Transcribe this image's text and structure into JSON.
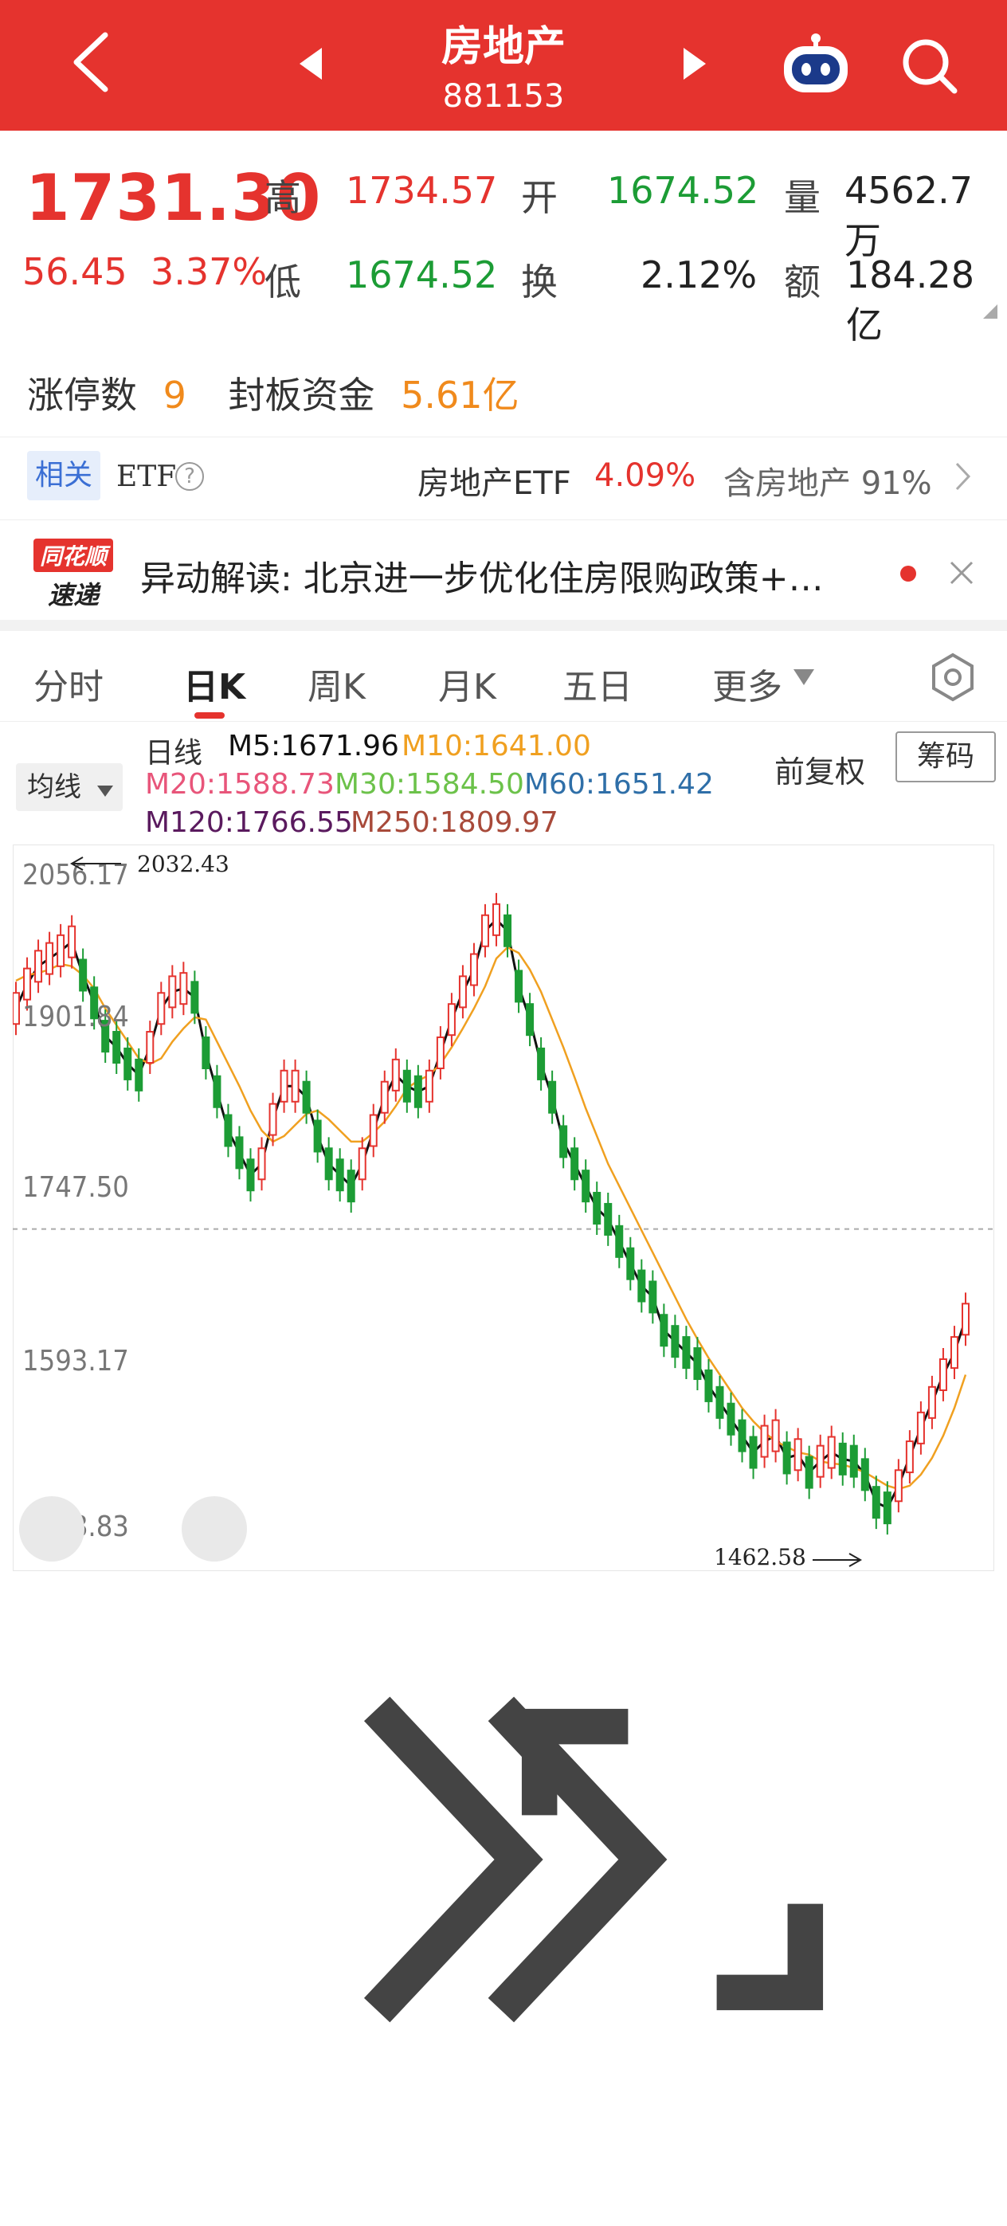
{
  "header": {
    "title": "房地产",
    "code": "881153"
  },
  "quote": {
    "price": "1731.30",
    "change": "56.45",
    "change_pct": "3.37%",
    "high_label": "高",
    "high": "1734.57",
    "open_label": "开",
    "open": "1674.52",
    "volume_label": "量",
    "volume": "4562.7万",
    "low_label": "低",
    "low": "1674.52",
    "turnover_label": "换",
    "turnover": "2.12%",
    "amount_label": "额",
    "amount": "184.28亿"
  },
  "limit_up": {
    "label": "涨停数",
    "count": "9",
    "fund_label": "封板资金",
    "fund": "5.61亿"
  },
  "etf": {
    "tag": "相关",
    "label": "ETF",
    "help": "?",
    "name": "房地产ETF",
    "pct": "4.09%",
    "contain": "含房地产 91%"
  },
  "news": {
    "logo_top": "同花顺",
    "logo_bottom": "速递",
    "text": "异动解读: 北京进一步优化住房限购政策+…"
  },
  "tabs": [
    {
      "label": "分时"
    },
    {
      "label": "日K"
    },
    {
      "label": "周K"
    },
    {
      "label": "月K"
    },
    {
      "label": "五日"
    },
    {
      "label": "更多"
    }
  ],
  "ma": {
    "button": "均线",
    "type": "日线",
    "m5": "M5:1671.96",
    "m10": "M10:1641.00",
    "m20": "M20:1588.73",
    "m30": "M30:1584.50",
    "m60": "M60:1651.42",
    "m120": "M120:1766.55",
    "m250": "M250:1809.97",
    "adjust": "前复权",
    "chips": "筹码"
  },
  "colors": {
    "up": "#e5332e",
    "down": "#1c9c35",
    "m5": "#111111",
    "m10": "#f0a020",
    "m20": "#e8557a",
    "m30": "#6cc24a",
    "m60": "#2f6fa8",
    "m120": "#5a1a5e",
    "m250": "#a84a3a"
  },
  "chart_data": {
    "type": "candlestick",
    "y_ticks": [
      "2056.17",
      "1901.84",
      "1747.50",
      "1593.17",
      "1438.83"
    ],
    "ylim": [
      1438.83,
      2056.17
    ],
    "high_annotation": "2032.43",
    "low_annotation": "1462.58",
    "current_line": 1731.3,
    "series": [
      {
        "name": "M5",
        "values": [
          1930,
          1952,
          1968,
          1975,
          1982,
          1990,
          1960,
          1935,
          1905,
          1895,
          1880,
          1870,
          1895,
          1930,
          1945,
          1948,
          1940,
          1890,
          1855,
          1820,
          1800,
          1780,
          1790,
          1830,
          1860,
          1860,
          1850,
          1815,
          1790,
          1780,
          1770,
          1790,
          1820,
          1850,
          1870,
          1860,
          1855,
          1860,
          1890,
          1920,
          1945,
          1965,
          2000,
          2010,
          2000,
          1950,
          1920,
          1880,
          1850,
          1810,
          1790,
          1770,
          1750,
          1740,
          1720,
          1700,
          1680,
          1670,
          1640,
          1630,
          1620,
          1610,
          1590,
          1575,
          1560,
          1545,
          1530,
          1540,
          1545,
          1525,
          1528,
          1512,
          1522,
          1530,
          1524,
          1522,
          1510,
          1485,
          1480,
          1500,
          1526,
          1552,
          1575,
          1600,
          1620,
          1650
        ]
      },
      {
        "name": "M10",
        "values": [
          1955,
          1960,
          1962,
          1965,
          1970,
          1968,
          1960,
          1948,
          1930,
          1915,
          1900,
          1885,
          1880,
          1885,
          1900,
          1912,
          1922,
          1920,
          1900,
          1880,
          1860,
          1838,
          1820,
          1810,
          1815,
          1825,
          1835,
          1838,
          1830,
          1820,
          1810,
          1810,
          1818,
          1828,
          1842,
          1858,
          1865,
          1870,
          1880,
          1895,
          1912,
          1930,
          1950,
          1975,
          1985,
          1980,
          1965,
          1945,
          1920,
          1895,
          1868,
          1840,
          1815,
          1790,
          1770,
          1750,
          1730,
          1710,
          1690,
          1670,
          1650,
          1632,
          1615,
          1600,
          1585,
          1570,
          1558,
          1548,
          1540,
          1535,
          1530,
          1528,
          1522,
          1520,
          1519,
          1516,
          1512,
          1506,
          1500,
          1497,
          1500,
          1510,
          1525,
          1545,
          1570,
          1600
        ]
      }
    ]
  }
}
